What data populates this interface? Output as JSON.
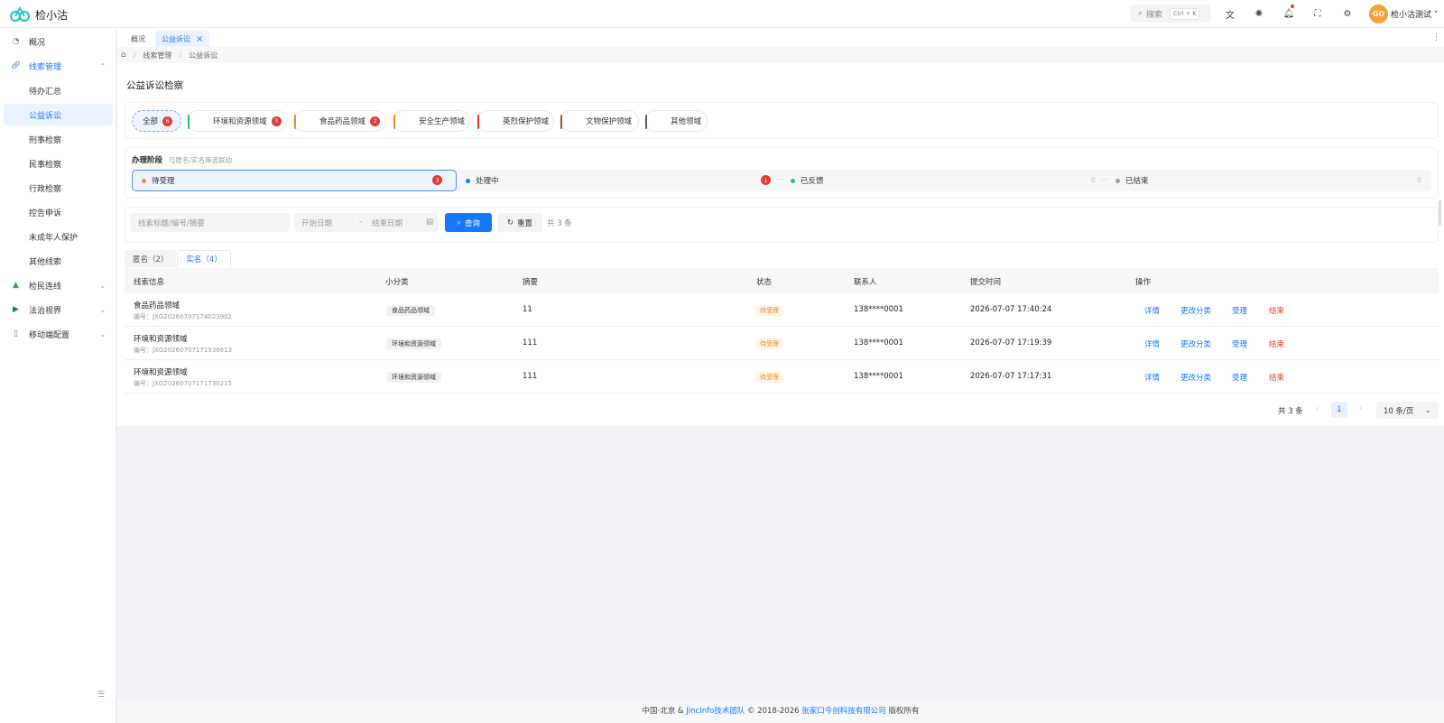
{
  "app": {
    "title": "检小沽",
    "logo_text": "GO"
  },
  "header": {
    "search_label": "搜索",
    "search_shortcut": "Ctrl + K",
    "user_name": "检小沽测试",
    "avatar_text": "GO",
    "icons": [
      "translate-icon",
      "theme-icon",
      "bell-icon",
      "fullscreen-icon",
      "gear-icon"
    ]
  },
  "sidebar": {
    "items": [
      {
        "label": "概况",
        "icon": "dashboard-icon"
      },
      {
        "label": "线索管理",
        "icon": "link-icon",
        "expanded": true
      },
      {
        "label": "待办汇总"
      },
      {
        "label": "公益诉讼",
        "active": true
      },
      {
        "label": "刑事检察"
      },
      {
        "label": "民事检察"
      },
      {
        "label": "行政检察"
      },
      {
        "label": "控告申诉"
      },
      {
        "label": "未成年人保护"
      },
      {
        "label": "其他线索"
      },
      {
        "label": "检民连线",
        "icon": "tree-icon"
      },
      {
        "label": "法治视界",
        "icon": "play-icon"
      },
      {
        "label": "移动端配置",
        "icon": "mobile-icon"
      }
    ]
  },
  "page_tabs": [
    {
      "label": "概况"
    },
    {
      "label": "公益诉讼",
      "active": true
    }
  ],
  "breadcrumb": [
    "线索管理",
    "公益诉讼"
  ],
  "main": {
    "title": "公益诉讼检察",
    "categories": [
      {
        "label": "全部",
        "count": "6",
        "color": ""
      },
      {
        "label": "环境和资源领域",
        "count": "3",
        "color": "#2fbf71"
      },
      {
        "label": "食品药品领域",
        "count": "2",
        "color": "#f08a24"
      },
      {
        "label": "安全生产领域",
        "count": "",
        "color": "#f08a24"
      },
      {
        "label": "英烈保护领域",
        "count": "",
        "color": "#e53935"
      },
      {
        "label": "文物保护领域",
        "count": "",
        "color": "#a0522d"
      },
      {
        "label": "其他领域",
        "count": "",
        "color": "#555d6b"
      }
    ],
    "stage": {
      "title": "办理阶段",
      "hint": "与匿名/实名筛选联动",
      "items": [
        {
          "label": "待受理",
          "count": "3",
          "color": "#f08a24"
        },
        {
          "label": "处理中",
          "count": "1",
          "color": "#1677ff"
        },
        {
          "label": "已反馈",
          "count": "0",
          "color": "#2fbf71"
        },
        {
          "label": "已结束",
          "count": "0",
          "color": "#999999"
        }
      ],
      "dash": "—"
    },
    "filter": {
      "keyword_placeholder": "线索标题/编号/摘要",
      "start_placeholder": "开始日期",
      "end_placeholder": "结束日期",
      "range_sep": "-",
      "query_label": "查询",
      "reset_label": "重置",
      "total_text": "共 3 条"
    },
    "name_tabs": [
      {
        "label": "匿名（2）"
      },
      {
        "label": "实名（4）",
        "active": true
      }
    ],
    "table": {
      "headers": [
        "线索信息",
        "小分类",
        "摘要",
        "状态",
        "联系人",
        "提交时间",
        "操作"
      ],
      "rows": [
        {
          "title": "食品药品领域",
          "code": "编号：JXG20260707174023902",
          "category": "食品药品领域",
          "summary": "11",
          "status": "待受理",
          "contact": "138****0001",
          "time": "2026-07-07 17:40:24"
        },
        {
          "title": "环境和资源领域",
          "code": "编号：JXG20260707171938613",
          "category": "环境和资源领域",
          "summary": "111",
          "status": "待受理",
          "contact": "138****0001",
          "time": "2026-07-07 17:19:39"
        },
        {
          "title": "环境和资源领域",
          "code": "编号：JXG20260707171730215",
          "category": "环境和资源领域",
          "summary": "111",
          "status": "待受理",
          "contact": "138****0001",
          "time": "2026-07-07 17:17:31"
        }
      ],
      "actions": [
        "详情",
        "更改分类",
        "受理",
        "结束"
      ]
    },
    "pagination": {
      "total_text": "共 3 条",
      "prev": "‹",
      "next": "›",
      "current_page": "1",
      "page_size": "10 条/页"
    }
  },
  "footer": {
    "prefix": "中国·北京 &",
    "team_link": "JincInfo技术团队",
    "copyright": "© 2018-2026",
    "company_link": "张家口今创科技有限公司",
    "suffix": "版权所有"
  },
  "colors": {
    "primary": "#1677ff",
    "danger": "#e53935",
    "warning": "#f08a24"
  }
}
